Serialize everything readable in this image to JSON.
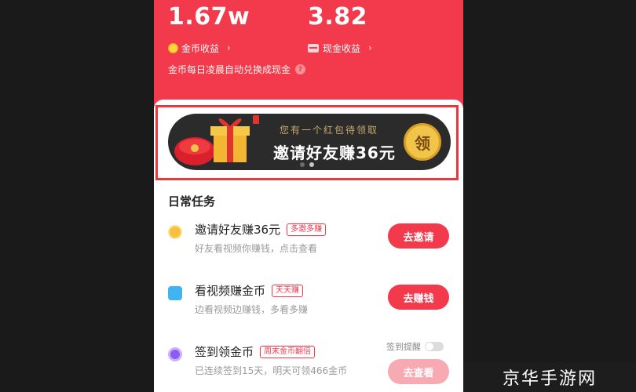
{
  "header": {
    "coin_value": "1.67w",
    "cash_value": "3.82",
    "coin_label": "金币收益",
    "cash_label": "现金收益",
    "chevron": "›",
    "convert_note": "金币每日凌晨自动兑换成现金",
    "help": "?"
  },
  "banner": {
    "subtitle": "您有一个红包待领取",
    "title": "邀请好友赚36元",
    "claim_label": "领",
    "pages": 2,
    "active_page": 1
  },
  "tasks": {
    "section_title": "日常任务",
    "items": [
      {
        "title": "邀请好友赚36元",
        "tag": "多邀多赚",
        "sub": "好友看视频你赚钱，点击查看",
        "button": "去邀请",
        "icon": "gold-coin-icon"
      },
      {
        "title": "看视频赚金币",
        "tag": "天天赚",
        "sub": "边看视频边赚钱，多看多赚",
        "button": "去赚钱",
        "icon": "tv-icon"
      },
      {
        "title": "签到领金币",
        "tag": "周末金币翻倍",
        "sub": "已连续签到15天，明天可领466金币",
        "button": "去查看",
        "icon": "checkin-icon",
        "remind_label": "签到提醒"
      }
    ]
  },
  "watermark": "京华手游网",
  "colors": {
    "primary_red": "#f23a4c",
    "banner_bg": "#2b2b2b",
    "gold": "#f0c54a",
    "highlight": "#e8383c"
  }
}
